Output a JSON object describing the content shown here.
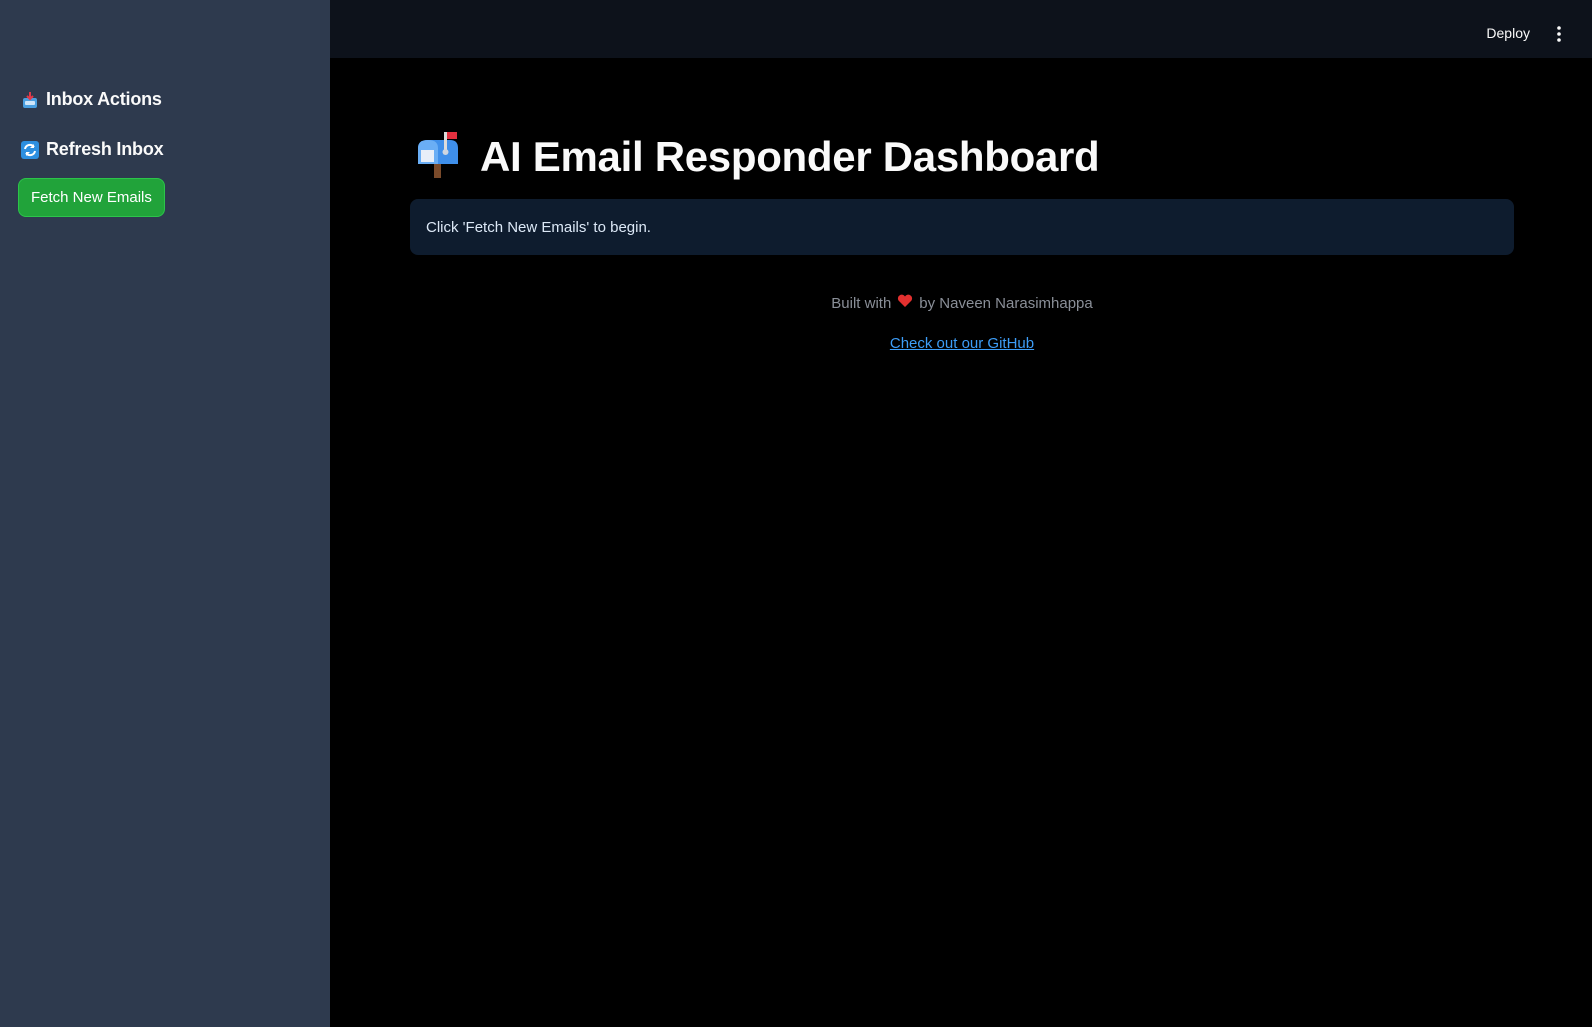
{
  "sidebar": {
    "heading_inbox": "Inbox Actions",
    "heading_refresh": "Refresh Inbox",
    "fetch_button": "Fetch New Emails"
  },
  "header": {
    "deploy": "Deploy"
  },
  "main": {
    "title": "AI Email Responder Dashboard",
    "info": "Click 'Fetch New Emails' to begin.",
    "footer_prefix": "Built with",
    "footer_suffix": "by Naveen Narasimhappa",
    "github_link": "Check out our GitHub"
  },
  "colors": {
    "sidebar_bg": "#2e3a4e",
    "button_green": "#21a33a",
    "link_blue": "#3d9df7",
    "info_bg": "#0e1c2e"
  },
  "icons": [
    "inbox-tray-icon",
    "refresh-arrows-icon",
    "mailbox-icon",
    "heart-icon",
    "kebab-menu-icon"
  ]
}
